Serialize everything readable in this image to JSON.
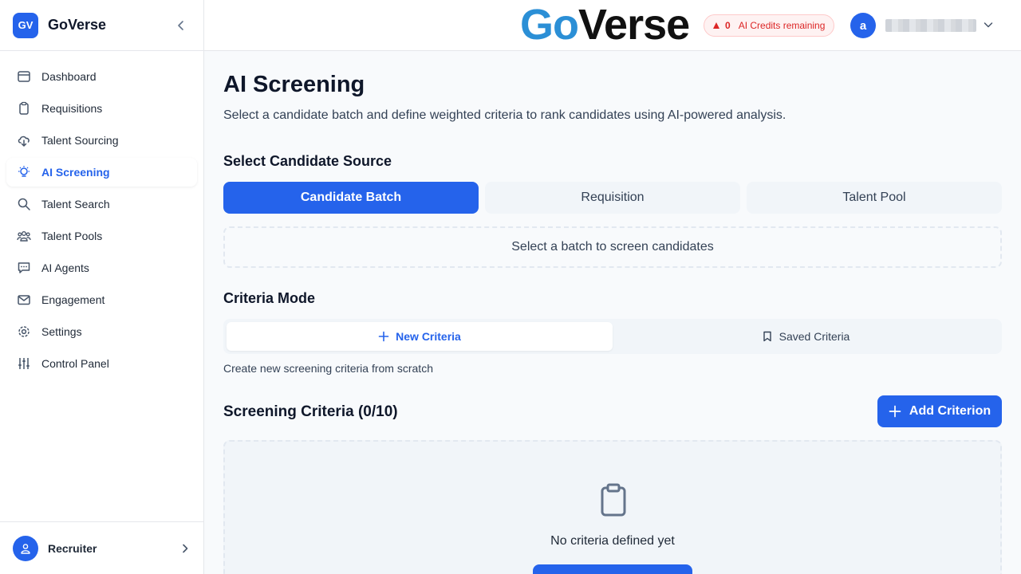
{
  "sidebar": {
    "logo_badge": "GV",
    "brand": "GoVerse",
    "nav": [
      {
        "label": "Dashboard",
        "icon": "dashboard-icon"
      },
      {
        "label": "Requisitions",
        "icon": "clipboard-icon"
      },
      {
        "label": "Talent Sourcing",
        "icon": "cloud-download-icon"
      },
      {
        "label": "AI Screening",
        "icon": "lightbulb-icon"
      },
      {
        "label": "Talent Search",
        "icon": "search-icon"
      },
      {
        "label": "Talent Pools",
        "icon": "users-icon"
      },
      {
        "label": "AI Agents",
        "icon": "chat-icon"
      },
      {
        "label": "Engagement",
        "icon": "mail-icon"
      },
      {
        "label": "Settings",
        "icon": "gear-icon"
      },
      {
        "label": "Control Panel",
        "icon": "sliders-icon"
      }
    ],
    "active_item": "AI Screening",
    "footer": {
      "role": "Recruiter"
    }
  },
  "topbar": {
    "logo_go": "Go",
    "logo_verse": "Verse",
    "credits_count": "0",
    "credits_label": "AI Credits remaining",
    "avatar_initial": "a"
  },
  "main": {
    "title": "AI Screening",
    "subtitle": "Select a candidate batch and define weighted criteria to rank candidates using AI-powered analysis.",
    "source_section": "Select Candidate Source",
    "source_tabs": [
      "Candidate Batch",
      "Requisition",
      "Talent Pool"
    ],
    "batch_placeholder": "Select a batch to screen candidates",
    "criteria_mode_section": "Criteria Mode",
    "mode_tabs": [
      "New Criteria",
      "Saved Criteria"
    ],
    "mode_help": "Create new screening criteria from scratch",
    "criteria_title": "Screening Criteria (0/10)",
    "add_criterion": "Add Criterion",
    "empty_text": "No criteria defined yet"
  },
  "colors": {
    "accent": "#2563eb",
    "credits_red": "#dc2626",
    "logo_blue": "#2b8fd6"
  }
}
